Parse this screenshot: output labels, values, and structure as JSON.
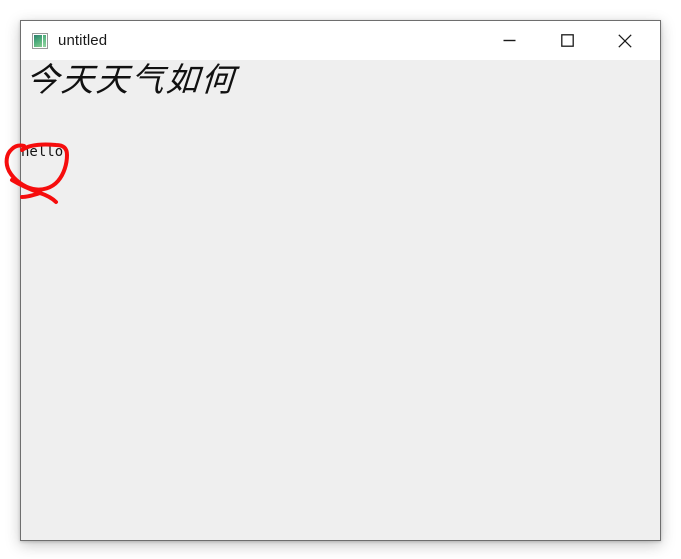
{
  "window": {
    "title": "untitled",
    "icon": "image-icon",
    "controls": {
      "minimize_label": "—",
      "maximize_label": "□",
      "close_label": "✕"
    },
    "colors": {
      "title_bar_bg": "#ffffff",
      "canvas_bg": "#efefef",
      "border": "#6e6e6e",
      "title_text": "#1a1a1a",
      "ink_red": "#f60d0d",
      "icon_green": "#4fae7c"
    }
  },
  "canvas": {
    "handwriting_text": "今天天气如何",
    "hello_text": "hello",
    "annotation": {
      "name": "red-circle-annotation",
      "color": "#f60d0d",
      "stroke_width": 4
    }
  }
}
